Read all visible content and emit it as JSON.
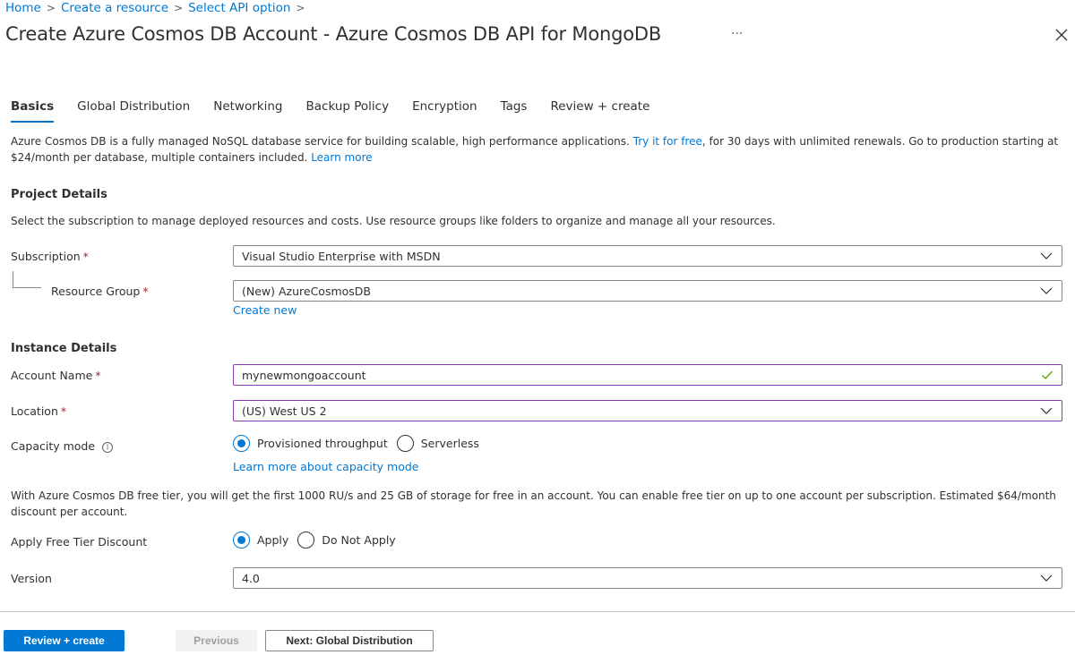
{
  "breadcrumb": {
    "items": [
      "Home",
      "Create a resource",
      "Select API option"
    ],
    "separator": ">"
  },
  "header": {
    "title": "Create Azure Cosmos DB Account - Azure Cosmos DB API for MongoDB",
    "more_icon": "···",
    "close_icon": "✕"
  },
  "tabs": [
    {
      "label": "Basics",
      "active": true
    },
    {
      "label": "Global Distribution",
      "active": false
    },
    {
      "label": "Networking",
      "active": false
    },
    {
      "label": "Backup Policy",
      "active": false
    },
    {
      "label": "Encryption",
      "active": false
    },
    {
      "label": "Tags",
      "active": false
    },
    {
      "label": "Review + create",
      "active": false
    }
  ],
  "intro": {
    "text_1": "Azure Cosmos DB is a fully managed NoSQL database service for building scalable, high performance applications. ",
    "link_try": "Try it for free",
    "text_2": ", for 30 days with unlimited renewals. Go to production starting at $24/month per database, multiple containers included. ",
    "link_learn": "Learn more"
  },
  "project_details": {
    "heading": "Project Details",
    "description": "Select the subscription to manage deployed resources and costs. Use resource groups like folders to organize and manage all your resources.",
    "subscription": {
      "label": "Subscription",
      "required_mark": "*",
      "value": "Visual Studio Enterprise with MSDN"
    },
    "resource_group": {
      "label": "Resource Group",
      "required_mark": "*",
      "value": "(New) AzureCosmosDB",
      "create_new": "Create new"
    }
  },
  "instance_details": {
    "heading": "Instance Details",
    "account_name": {
      "label": "Account Name",
      "required_mark": "*",
      "value": "mynewmongoaccount",
      "valid": true
    },
    "location": {
      "label": "Location",
      "required_mark": "*",
      "value": "(US) West US 2"
    },
    "capacity_mode": {
      "label": "Capacity mode",
      "info_icon": "i",
      "options": [
        {
          "label": "Provisioned throughput",
          "selected": true
        },
        {
          "label": "Serverless",
          "selected": false
        }
      ],
      "learn_more": "Learn more about capacity mode"
    },
    "free_tier_text": "With Azure Cosmos DB free tier, you will get the first 1000 RU/s and 25 GB of storage for free in an account. You can enable free tier on up to one account per subscription. Estimated $64/month discount per account.",
    "free_tier": {
      "label": "Apply Free Tier Discount",
      "options": [
        {
          "label": "Apply",
          "selected": true
        },
        {
          "label": "Do Not Apply",
          "selected": false
        }
      ]
    },
    "version": {
      "label": "Version",
      "value": "4.0"
    }
  },
  "footer": {
    "review_create": "Review + create",
    "previous": "Previous",
    "next": "Next: Global Distribution"
  },
  "colors": {
    "accent": "#0078d4",
    "required": "#a4262c",
    "valid_check": "#57a300",
    "focus_border": "#8a3cb5"
  }
}
